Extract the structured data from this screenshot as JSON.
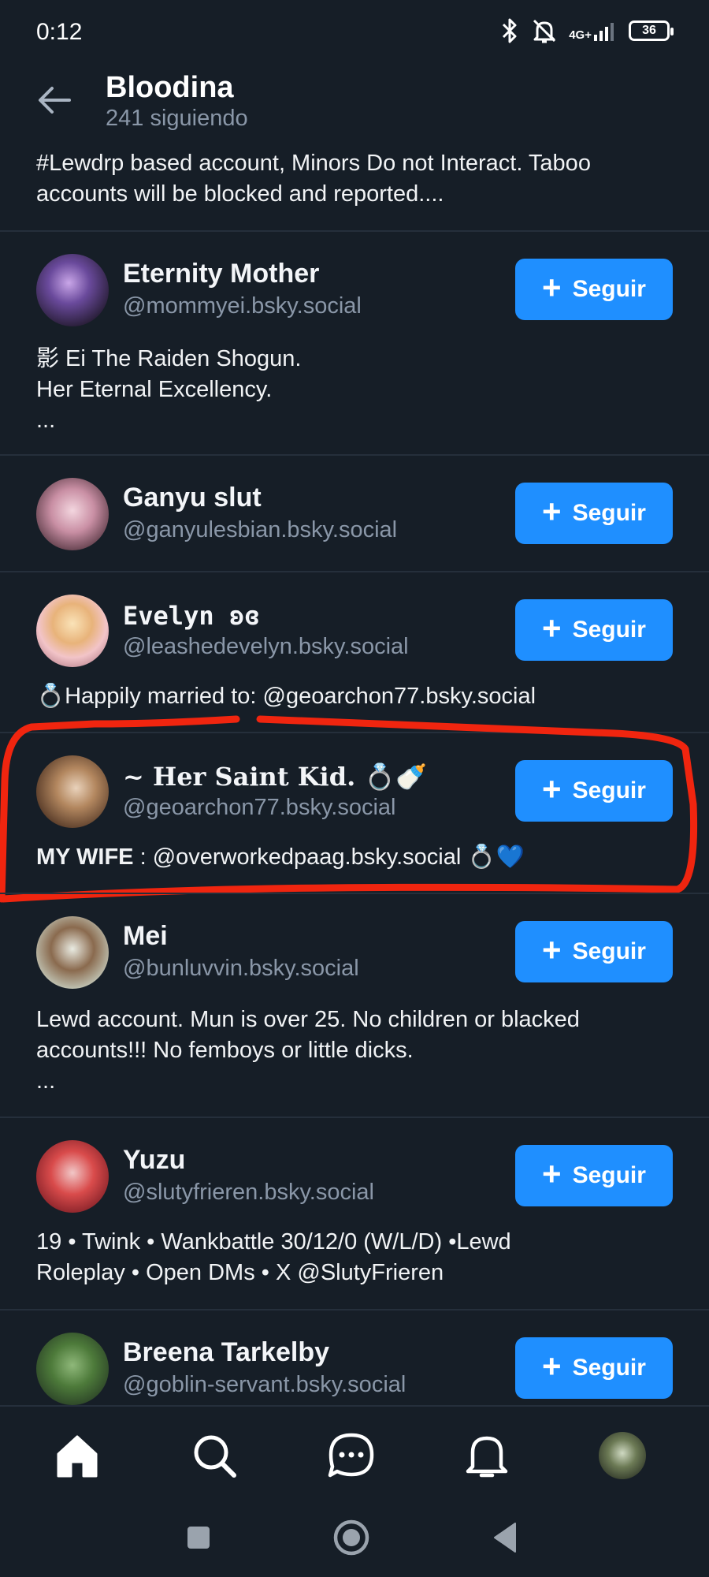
{
  "status_bar": {
    "time": "0:12",
    "network": "4G+",
    "battery": "36"
  },
  "header": {
    "title": "Bloodina",
    "subtitle": "241 siguiendo"
  },
  "top_bio": "#Lewdrp based account, Minors Do not Interact. Taboo accounts will be blocked and reported....",
  "follow_label": "Seguir",
  "follow_plus": "+",
  "accounts": [
    {
      "name": "Eternity Mother",
      "handle": "@mommyei.bsky.social",
      "bio_lines": [
        "影 Ei The Raiden Shogun.",
        "Her Eternal Excellency.",
        "..."
      ]
    },
    {
      "name": "Ganyu slut",
      "handle": "@ganyulesbian.bsky.social"
    },
    {
      "name": "Evelyn ʚɞ",
      "handle": "@leashedevelyn.bsky.social",
      "bio": "💍Happily married to: @geoarchon77.bsky.social"
    },
    {
      "name": "~ Her Saint Kid. 💍🍼",
      "handle": "@geoarchon77.bsky.social",
      "bio_bold": "MY WIFE",
      "bio_rest": " : @overworkedpaag.bsky.social 💍💙"
    },
    {
      "name": "Mei",
      "handle": "@bunluvvin.bsky.social",
      "bio_lines": [
        "Lewd account. Mun is over 25. No children or blacked",
        "accounts!!! No femboys or little dicks.",
        "..."
      ]
    },
    {
      "name": "Yuzu",
      "handle": "@slutyfrieren.bsky.social",
      "bio_lines": [
        "19 • Twink • Wankbattle 30/12/0 (W/L/D) •Lewd",
        "Roleplay • Open DMs • X @SlutyFrieren"
      ]
    },
    {
      "name": "Breena Tarkelby",
      "handle": "@goblin-servant.bsky.social"
    }
  ],
  "colors": {
    "background": "#161e27",
    "accent": "#1f8fff",
    "muted_text": "#8a97a8",
    "annotation": "#f0250f"
  },
  "bottom_nav": [
    "home-icon",
    "search-icon",
    "chat-icon",
    "bell-icon",
    "profile-avatar"
  ],
  "system_nav": [
    "recents-square-icon",
    "home-circle-icon",
    "back-triangle-icon"
  ]
}
